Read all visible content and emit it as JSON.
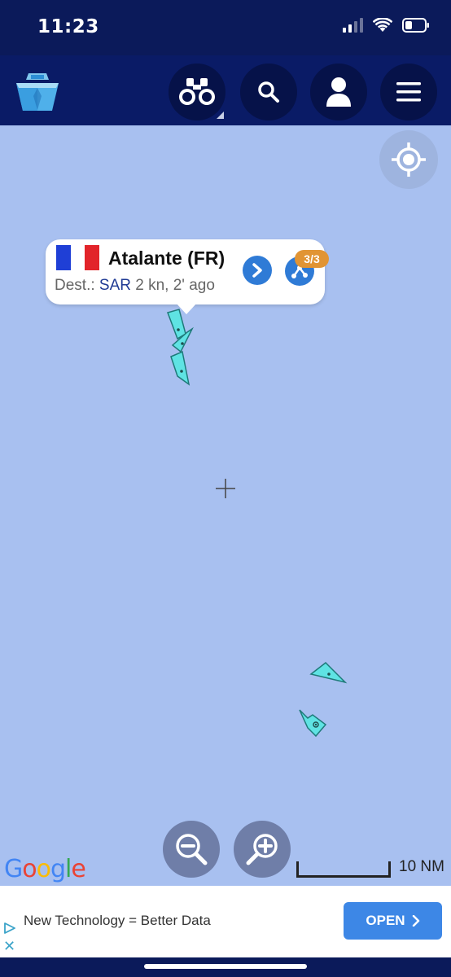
{
  "status_bar": {
    "time": "11:23"
  },
  "header": {
    "logo": "ship-logo-icon",
    "buttons": [
      "binoculars-icon",
      "search-icon",
      "account-icon",
      "menu-icon"
    ]
  },
  "map": {
    "popup": {
      "flag": [
        "#1f3fd6",
        "#ffffff",
        "#e2242a"
      ],
      "vessel_name": "Atalante (FR)",
      "dest_label": "Dest.:",
      "dest_value": "SAR",
      "speed_time": "2 kn, 2' ago",
      "count_badge": "3/3"
    },
    "scale_label": "10 NM",
    "google_logo": [
      "G",
      "o",
      "o",
      "g",
      "l",
      "e"
    ],
    "colors": {
      "vessel_fill": "#5fe3e3",
      "vessel_stroke": "#1f7a7a",
      "map_water": "#a8c0f0"
    }
  },
  "ad": {
    "text": "New Technology = Better Data",
    "button": "OPEN"
  }
}
